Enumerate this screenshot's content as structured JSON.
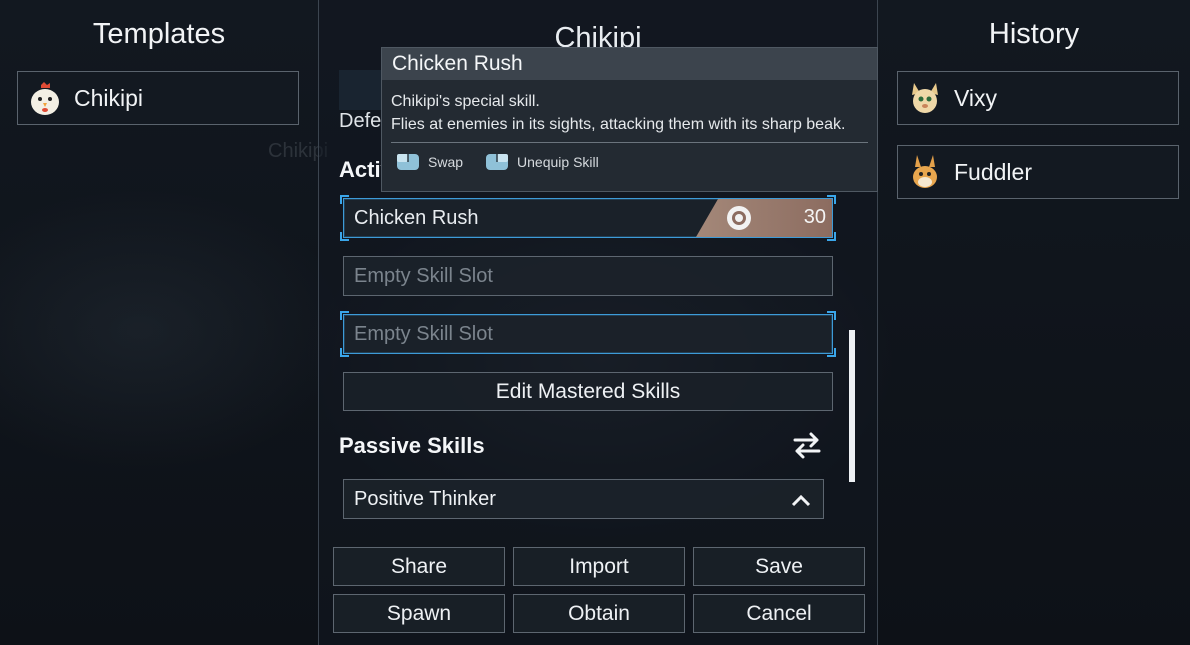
{
  "left_panel": {
    "title": "Templates",
    "items": [
      {
        "label": "Chikipi",
        "icon": "chikipi-icon"
      }
    ]
  },
  "right_panel": {
    "title": "History",
    "items": [
      {
        "label": "Vixy",
        "icon": "vixy-icon"
      },
      {
        "label": "Fuddler",
        "icon": "fuddler-icon"
      }
    ]
  },
  "middle_panel": {
    "title": "Chikipi",
    "defense_label": "Defe",
    "active_label": "Activ",
    "active_skills": [
      {
        "label": "Chicken Rush",
        "cost": "30",
        "element": "neutral-element-icon"
      },
      {
        "label": "Empty Skill Slot"
      },
      {
        "label": "Empty Skill Slot"
      }
    ],
    "edit_mastered": "Edit Mastered Skills",
    "passive_label": "Passive Skills",
    "passive_skills": [
      {
        "label": "Positive Thinker",
        "icon": "chevron-up-icon"
      }
    ],
    "buttons": {
      "share": "Share",
      "import": "Import",
      "save": "Save",
      "spawn": "Spawn",
      "obtain": "Obtain",
      "cancel": "Cancel"
    }
  },
  "tooltip": {
    "title": "Chicken Rush",
    "line1": "Chikipi's special skill.",
    "line2": "Flies at enemies in its sights, attacking them with its sharp beak.",
    "actions": [
      {
        "label": "Swap",
        "icon": "mouse-left-icon"
      },
      {
        "label": "Unequip Skill",
        "icon": "mouse-right-icon"
      }
    ]
  },
  "background_hint": "Chikipi",
  "colors": {
    "selection": "#3aa6ea",
    "cost_badge": "#a48879"
  }
}
